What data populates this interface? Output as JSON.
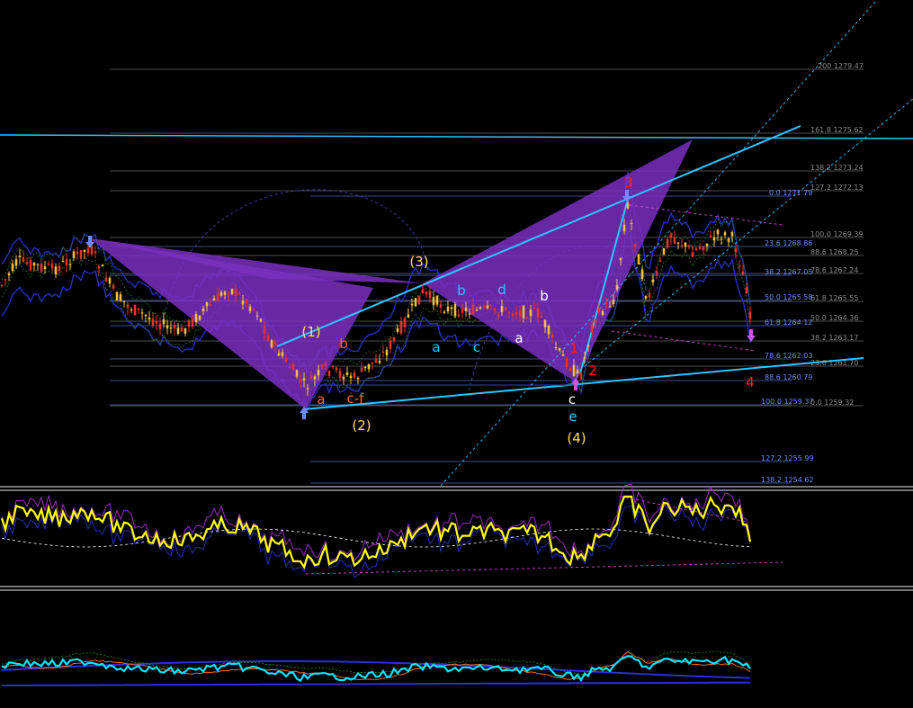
{
  "chart_data": {
    "type": "candlestick",
    "fib_levels": [
      {
        "label": "200 1279.47",
        "value": 1279.47,
        "color": "#8a8a8a"
      },
      {
        "label": "161.8 1275.62",
        "value": 1275.62,
        "color": "#8a8a8a"
      },
      {
        "label": "138.2 1273.24",
        "value": 1273.24,
        "color": "#8a8a8a"
      },
      {
        "label": "127.2 1272.13",
        "value": 1272.13,
        "color": "#8a8a8a"
      },
      {
        "label": "0.0 1271.79",
        "value": 1271.79,
        "color": "#6f8cff"
      },
      {
        "label": "100.0 1269.39",
        "value": 1269.39,
        "color": "#8a8a8a"
      },
      {
        "label": "23.6 1268.86",
        "value": 1268.86,
        "color": "#6f8cff"
      },
      {
        "label": "88.6 1268.25",
        "value": 1268.25,
        "color": "#8a8a8a"
      },
      {
        "label": "78.6 1267.24",
        "value": 1267.24,
        "color": "#8a8a8a"
      },
      {
        "label": "38.2 1267.05",
        "value": 1267.05,
        "color": "#6f8cff"
      },
      {
        "label": "61.8 1265.55",
        "value": 1265.55,
        "color": "#8a8a8a"
      },
      {
        "label": "50.0 1265.58",
        "value": 1265.58,
        "color": "#6f8cff"
      },
      {
        "label": "50.0 1264.36",
        "value": 1264.36,
        "color": "#8a8a8a"
      },
      {
        "label": "61.8 1264.12",
        "value": 1264.12,
        "color": "#6f8cff"
      },
      {
        "label": "38.2 1263.17",
        "value": 1263.17,
        "color": "#8a8a8a"
      },
      {
        "label": "78.6 1262.03",
        "value": 1262.03,
        "color": "#6f8cff"
      },
      {
        "label": "23.6 1261.70",
        "value": 1261.7,
        "color": "#8a8a8a"
      },
      {
        "label": "88.6 1260.79",
        "value": 1260.79,
        "color": "#6f8cff"
      },
      {
        "label": "100.0 1259.37",
        "value": 1259.37,
        "color": "#6f8cff"
      },
      {
        "label": "0.0 1259.32",
        "value": 1259.32,
        "color": "#8a8a8a"
      },
      {
        "label": "127.2 1255.99",
        "value": 1255.99,
        "color": "#6f8cff"
      },
      {
        "label": "138.2 1254.62",
        "value": 1254.62,
        "color": "#6f8cff"
      }
    ],
    "wave_labels": [
      {
        "text": "(1)",
        "color": "#ffe14d"
      },
      {
        "text": "(2)",
        "color": "#ffe14d"
      },
      {
        "text": "(3)",
        "color": "#ffe14d"
      },
      {
        "text": "(4)",
        "color": "#ffe14d"
      },
      {
        "text": "a",
        "color": "#ff6a1a"
      },
      {
        "text": "b",
        "color": "#ff6a1a"
      },
      {
        "text": "c-f",
        "color": "#ff6a1a"
      },
      {
        "text": "a",
        "color": "#2ec4ff"
      },
      {
        "text": "b",
        "color": "#2ec4ff"
      },
      {
        "text": "c",
        "color": "#2ec4ff"
      },
      {
        "text": "d",
        "color": "#2ec4ff"
      },
      {
        "text": "e",
        "color": "#2ec4ff"
      },
      {
        "text": "a",
        "color": "#ffffff"
      },
      {
        "text": "b",
        "color": "#ffffff"
      },
      {
        "text": "c",
        "color": "#ffffff"
      },
      {
        "text": "1",
        "color": "#ff2020"
      },
      {
        "text": "2",
        "color": "#ff2020"
      },
      {
        "text": "3",
        "color": "#ff2020"
      },
      {
        "text": "4",
        "color": "#ff2020"
      }
    ],
    "colors": {
      "background": "#000000",
      "bull": "#f2c23c",
      "bear": "#e8342a",
      "pattern": "#7a2fbf",
      "trendline": "#2ec4ff",
      "oscillator": "#ffff00",
      "oscillator2": "#00e5ff"
    }
  }
}
